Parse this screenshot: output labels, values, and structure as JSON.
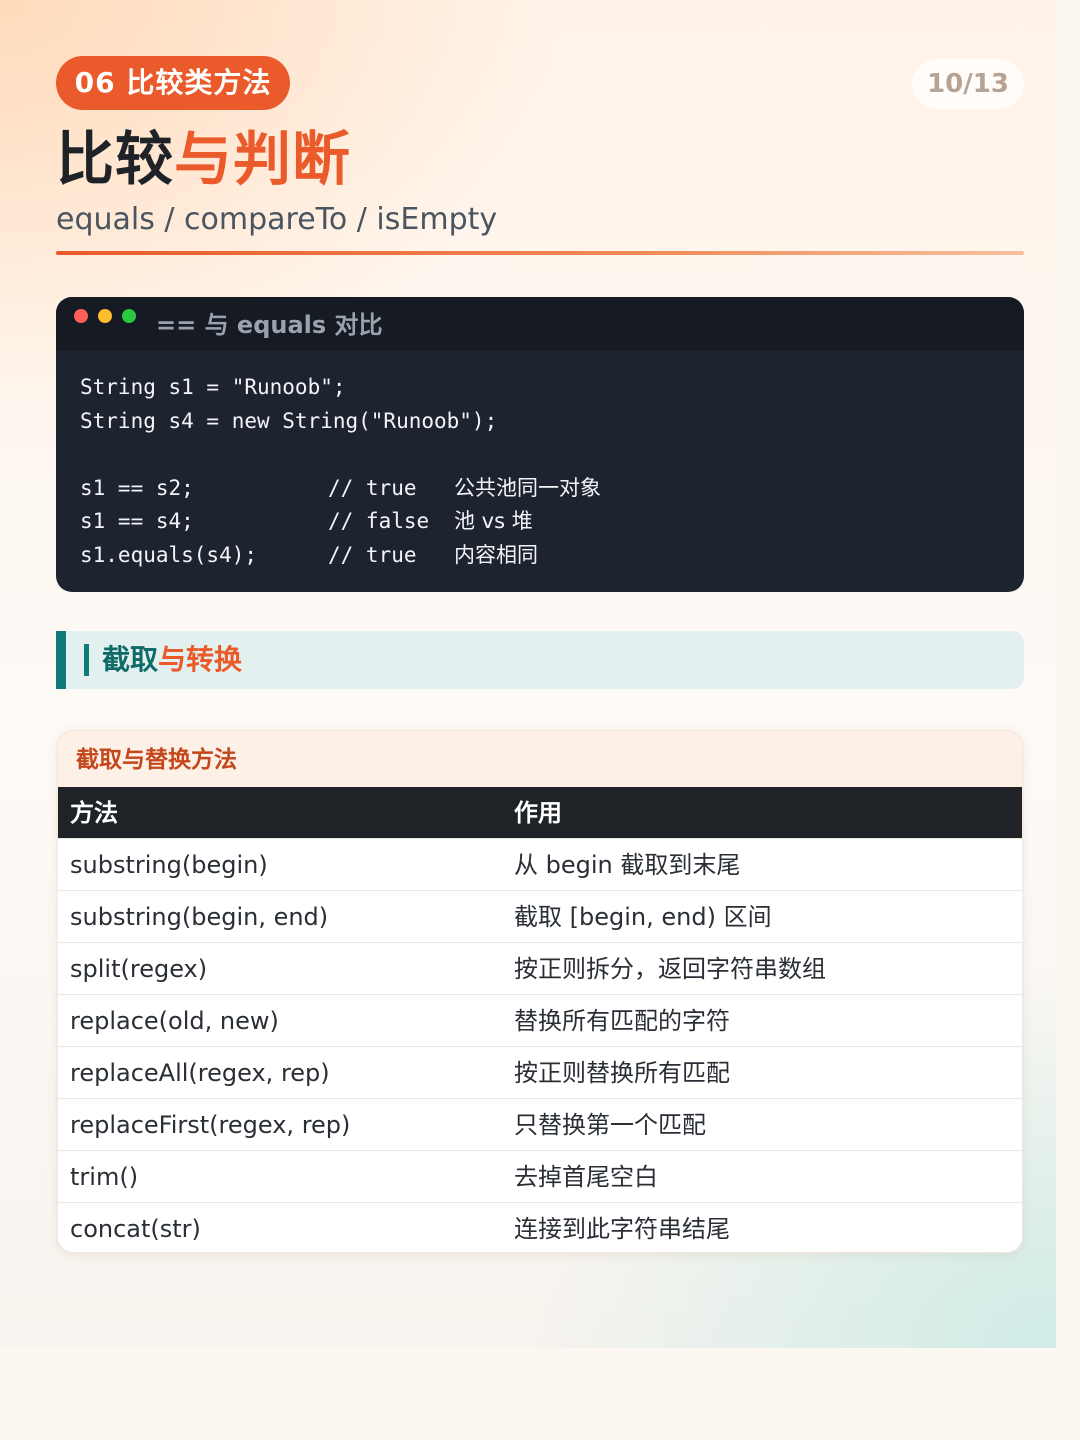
{
  "header": {
    "chip": "06 比较类方法",
    "page_indicator": "10/13",
    "title_plain": "比较",
    "title_accent": "与判断",
    "subtitle": "equals / compareTo / isEmpty"
  },
  "code_block": {
    "title": "== 与 equals 对比",
    "lines": [
      {
        "code": "String s1 = \"Runoob\";",
        "comment": "",
        "note": ""
      },
      {
        "code": "String s4 = new String(\"Runoob\");",
        "comment": "",
        "note": ""
      },
      {
        "code": "",
        "comment": "",
        "note": ""
      },
      {
        "code": "s1 == s2;",
        "comment": "// true",
        "note": "公共池同一对象"
      },
      {
        "code": "s1 == s4;",
        "comment": "// false",
        "note": "池 vs 堆"
      },
      {
        "code": "s1.equals(s4);",
        "comment": "// true",
        "note": "内容相同"
      }
    ]
  },
  "section": {
    "title_plain": "截取",
    "title_accent": "与转换"
  },
  "table": {
    "caption": "截取与替换方法",
    "headers": [
      "方法",
      "作用"
    ],
    "rows": [
      [
        "substring(begin)",
        "从 begin 截取到末尾"
      ],
      [
        "substring(begin, end)",
        "截取 [begin, end) 区间"
      ],
      [
        "split(regex)",
        "按正则拆分，返回字符串数组"
      ],
      [
        "replace(old, new)",
        "替换所有匹配的字符"
      ],
      [
        "replaceAll(regex, rep)",
        "按正则替换所有匹配"
      ],
      [
        "replaceFirst(regex, rep)",
        "只替换第一个匹配"
      ],
      [
        "trim()",
        "去掉首尾空白"
      ],
      [
        "concat(str)",
        "连接到此字符串结尾"
      ]
    ]
  },
  "colors": {
    "accent": "#ea5a2a",
    "teal": "#0f7a77",
    "code_bg": "#1e2330",
    "table_header_bg": "#1f2328"
  }
}
